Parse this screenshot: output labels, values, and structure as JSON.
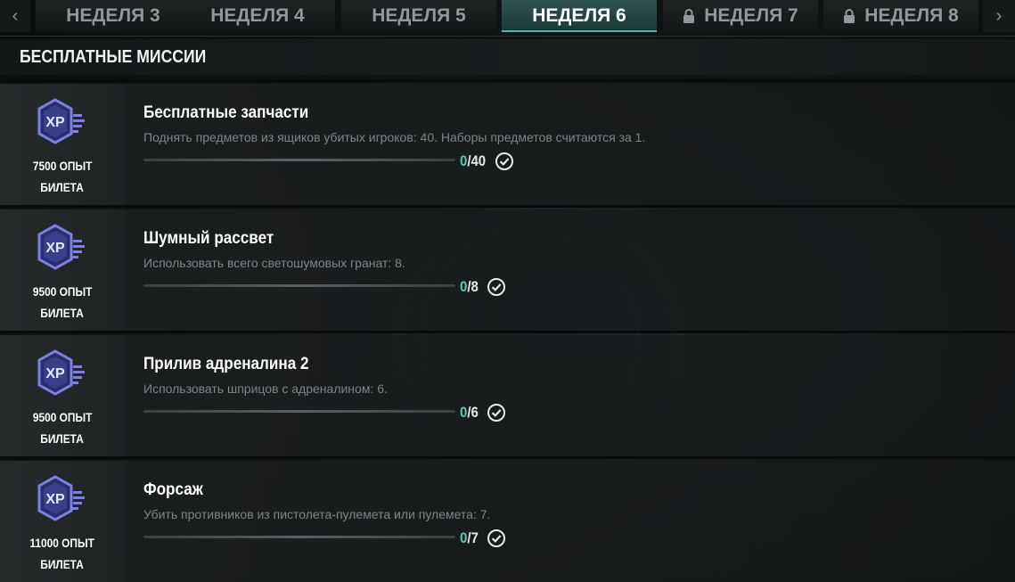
{
  "tabs": {
    "items": [
      {
        "label": "НЕДЕЛЯ 3",
        "locked": false,
        "active": false
      },
      {
        "label": "НЕДЕЛЯ 4",
        "locked": false,
        "active": false
      },
      {
        "label": "НЕДЕЛЯ 5",
        "locked": false,
        "active": false
      },
      {
        "label": "НЕДЕЛЯ 6",
        "locked": false,
        "active": true
      },
      {
        "label": "НЕДЕЛЯ 7",
        "locked": true,
        "active": false
      },
      {
        "label": "НЕДЕЛЯ 8",
        "locked": true,
        "active": false
      }
    ],
    "prev_arrow": "‹",
    "next_arrow": "›"
  },
  "section": {
    "title": "БЕСПЛАТНЫЕ МИССИИ"
  },
  "colors": {
    "accent": "#4fb7ae",
    "xp_icon": "#6f73d9"
  },
  "missions": [
    {
      "reward_line1": "7500 ОПЫТ",
      "reward_line2": "БИЛЕТА",
      "title": "Бесплатные запчасти",
      "description": "Поднять предметов из ящиков убитых игроков: 40. Наборы предметов считаются за 1.",
      "current": "0",
      "total": "/40",
      "progress": 0
    },
    {
      "reward_line1": "9500 ОПЫТ",
      "reward_line2": "БИЛЕТА",
      "title": "Шумный рассвет",
      "description": "Использовать всего светошумовых гранат: 8.",
      "current": "0",
      "total": "/8",
      "progress": 0
    },
    {
      "reward_line1": "9500 ОПЫТ",
      "reward_line2": "БИЛЕТА",
      "title": "Прилив адреналина 2",
      "description": "Использовать шприцов с адреналином: 6.",
      "current": "0",
      "total": "/6",
      "progress": 0
    },
    {
      "reward_line1": "11000 ОПЫТ",
      "reward_line2": "БИЛЕТА",
      "title": "Форсаж",
      "description": "Убить противников из пистолета-пулемета или пулемета: 7.",
      "current": "0",
      "total": "/7",
      "progress": 0
    }
  ],
  "icons": {
    "xp": "xp-badge-icon",
    "check": "check-circle-icon",
    "lock": "lock-icon"
  }
}
